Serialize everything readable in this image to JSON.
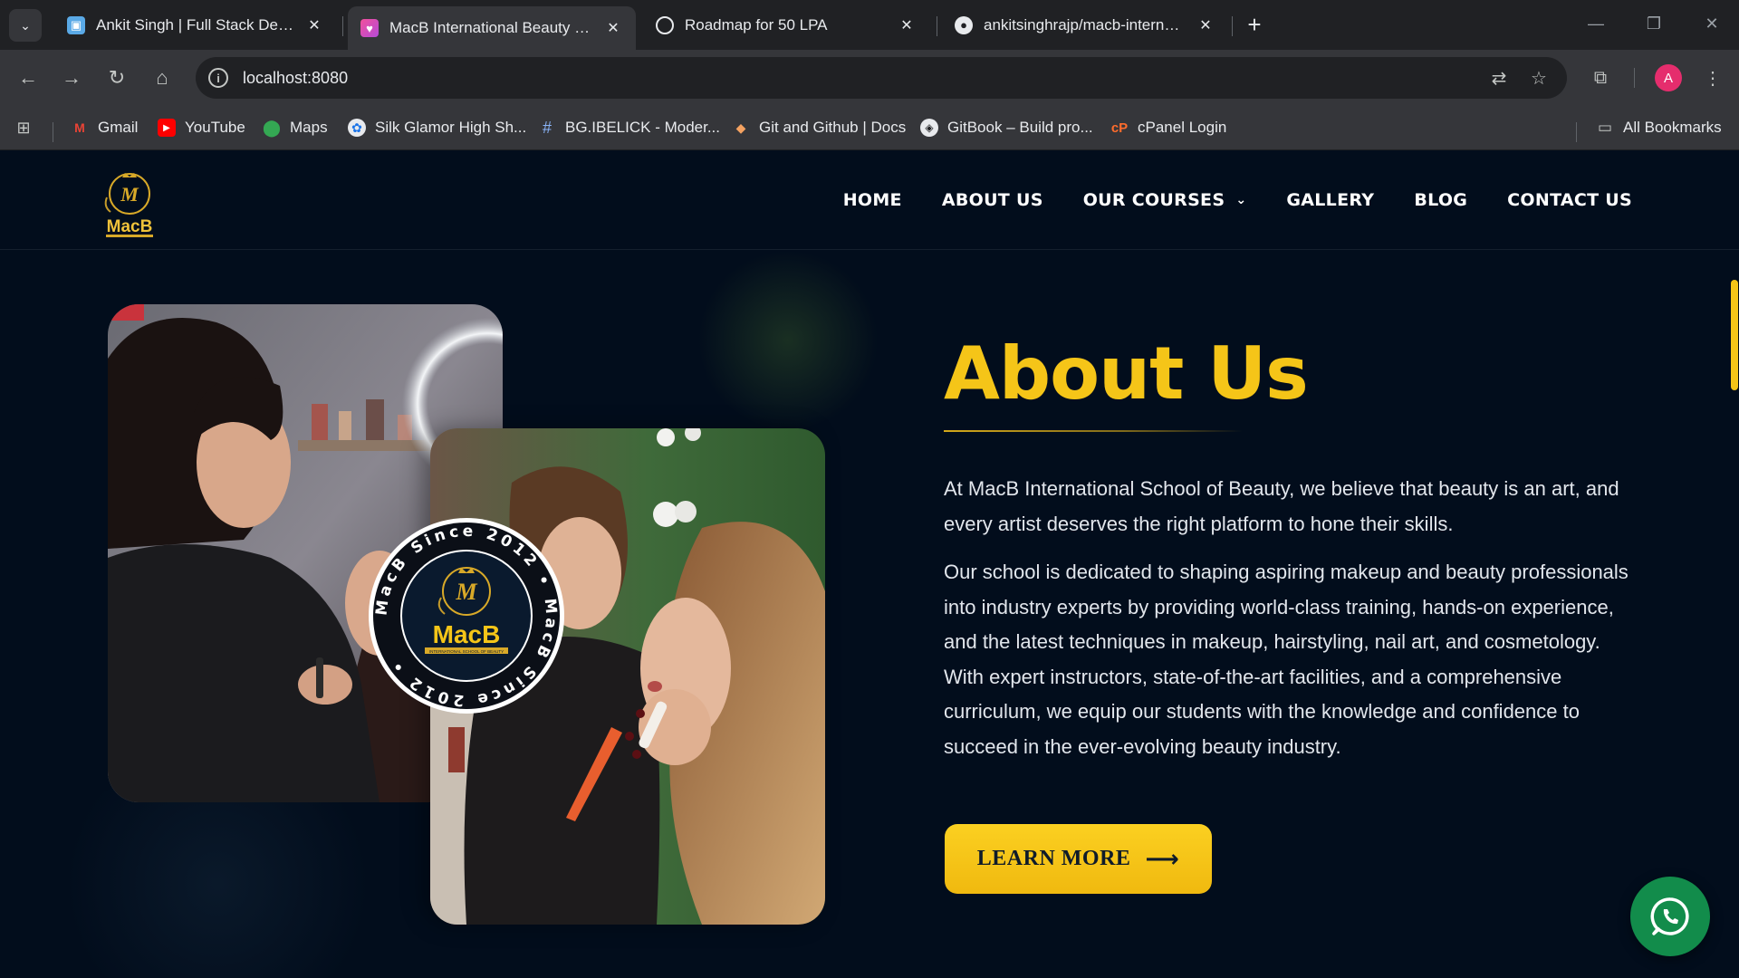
{
  "browser": {
    "tabs": [
      {
        "title": "Ankit Singh | Full Stack Develop",
        "favicon": "briefcase-icon",
        "active": false
      },
      {
        "title": "MacB International Beauty of Sc",
        "favicon": "makeup-icon",
        "active": true
      },
      {
        "title": "Roadmap for 50 LPA",
        "favicon": "openai-icon",
        "active": false
      },
      {
        "title": "ankitsinghrajp/macb-internatio",
        "favicon": "github-icon",
        "active": false
      }
    ],
    "url": "localhost:8080",
    "profile_initial": "A",
    "bookmarks": [
      {
        "label": "Gmail",
        "icon": "gmail-icon"
      },
      {
        "label": "YouTube",
        "icon": "youtube-icon"
      },
      {
        "label": "Maps",
        "icon": "maps-icon"
      },
      {
        "label": "Silk Glamor High Sh...",
        "icon": "silk-icon"
      },
      {
        "label": "BG.IBELICK - Moder...",
        "icon": "hash-icon"
      },
      {
        "label": "Git and Github | Docs",
        "icon": "git-icon"
      },
      {
        "label": "GitBook – Build pro...",
        "icon": "gitbook-icon"
      },
      {
        "label": "cPanel Login",
        "icon": "cpanel-icon"
      }
    ],
    "all_bookmarks": "All Bookmarks"
  },
  "site": {
    "logo_text": "MacB",
    "nav": [
      "HOME",
      "ABOUT US",
      "OUR COURSES",
      "GALLERY",
      "BLOG",
      "CONTACT US"
    ],
    "about": {
      "title": "About Us",
      "paragraph1": "At MacB International School of Beauty, we believe that beauty is an art, and every artist deserves the right platform to hone their skills.",
      "paragraph2": "Our school is dedicated to shaping aspiring makeup and beauty professionals into industry experts by providing world-class training, hands-on experience, and the latest techniques in makeup, hairstyling, nail art, and cosmetology. With expert instructors, state-of-the-art facilities, and a comprehensive curriculum, we equip our students with the knowledge and confidence to succeed in the ever-evolving beauty industry.",
      "button_label": "LEARN MORE"
    },
    "badge": {
      "ring_text": "MacB Since 2012 • MacB Since 2012 •",
      "brand": "MacB",
      "tagline": "INTERNATIONAL SCHOOL OF BEAUTY"
    },
    "colors": {
      "accent": "#f5c518",
      "background": "#020d1c",
      "whatsapp": "#128c4b"
    }
  }
}
